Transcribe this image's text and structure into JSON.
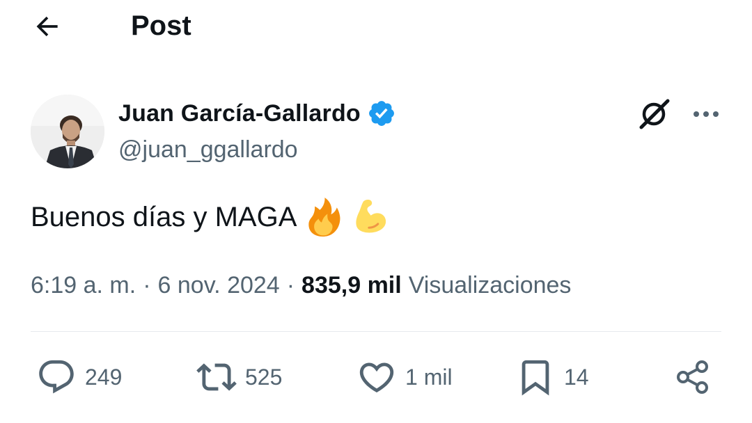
{
  "header": {
    "title": "Post",
    "back_icon": "arrow-left-icon"
  },
  "author": {
    "name": "Juan García-Gallardo",
    "handle": "@juan_ggallardo",
    "verified": true,
    "verified_color": "#1d9bf0"
  },
  "post": {
    "text": "Buenos días y MAGA",
    "emojis": [
      "fire-emoji",
      "flexed-biceps-emoji"
    ],
    "time": "6:19 a. m.",
    "date": "6 nov. 2024",
    "views_count": "835,9 mil",
    "views_label": "Visualizaciones"
  },
  "actions": {
    "replies": "249",
    "reposts": "525",
    "likes": "1 mil",
    "bookmarks": "14"
  },
  "colors": {
    "text_primary": "#0f1419",
    "text_secondary": "#536471",
    "divider": "#e6eaed"
  }
}
